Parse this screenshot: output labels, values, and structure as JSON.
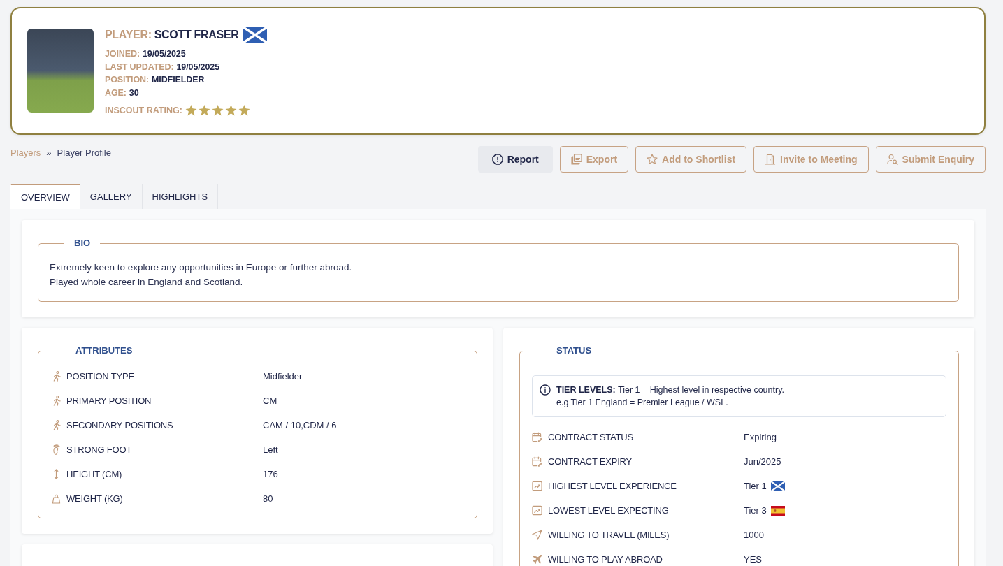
{
  "player": {
    "label": "PLAYER:",
    "name": "SCOTT FRASER",
    "flag": {
      "kind": "scotland"
    },
    "fields": [
      {
        "label": "JOINED:",
        "value": "19/05/2025"
      },
      {
        "label": "LAST UPDATED:",
        "value": "19/05/2025"
      },
      {
        "label": "POSITION:",
        "value": "MIDFIELDER"
      },
      {
        "label": "AGE:",
        "value": "30"
      }
    ],
    "rating": {
      "label": "INSCOUT RATING:",
      "stars": 5
    }
  },
  "breadcrumb": [
    {
      "label": "Players",
      "kind": "link"
    },
    {
      "label": "»",
      "kind": "separator"
    },
    {
      "label": "Player Profile",
      "kind": "current"
    }
  ],
  "actions": [
    {
      "label": "Report",
      "kind": "report"
    },
    {
      "label": "Export",
      "kind": "export"
    },
    {
      "label": "Add to Shortlist",
      "kind": "shortlist"
    },
    {
      "label": "Invite to Meeting",
      "kind": "meeting"
    },
    {
      "label": "Submit Enquiry",
      "kind": "enquiry"
    }
  ],
  "tabs": [
    {
      "label": "OVERVIEW",
      "selected": true
    },
    {
      "label": "GALLERY",
      "selected": false
    },
    {
      "label": "HIGHLIGHTS",
      "selected": false
    }
  ],
  "bio": {
    "title": "BIO",
    "text": "Extremely keen to explore any opportunities in Europe or further abroad.\nPlayed whole career in England and Scotland."
  },
  "attributes": {
    "title": "ATTRIBUTES",
    "rows": [
      {
        "kind": "position",
        "label": "POSITION TYPE",
        "value": "Midfielder"
      },
      {
        "kind": "position",
        "label": "PRIMARY POSITION",
        "value": "CM"
      },
      {
        "kind": "position",
        "label": "SECONDARY POSITIONS",
        "value": "CAM / 10,CDM / 6"
      },
      {
        "kind": "foot",
        "label": "STRONG FOOT",
        "value": "Left"
      },
      {
        "kind": "height",
        "label": "HEIGHT (CM)",
        "value": "176"
      },
      {
        "kind": "weight",
        "label": "WEIGHT (KG)",
        "value": "80"
      }
    ]
  },
  "status": {
    "title": "STATUS",
    "note": "**TIER LEVELS:** Tier 1 = Highest level in respective country.\ne.g Tier 1 England = Premier League / WSL.",
    "rows": [
      {
        "kind": "contract",
        "label": "CONTRACT STATUS",
        "value": "Expiring"
      },
      {
        "kind": "contract",
        "label": "CONTRACT EXPIRY",
        "value": "Jun/2025"
      },
      {
        "kind": "level",
        "label": "HIGHEST LEVEL EXPERIENCE",
        "value": "Tier 1",
        "flag": {
          "kind": "scotland"
        }
      },
      {
        "kind": "level",
        "label": "LOWEST LEVEL EXPECTING",
        "value": "Tier 3",
        "flag": {
          "kind": "spain"
        }
      },
      {
        "kind": "travel",
        "label": "WILLING TO TRAVEL (MILES)",
        "value": "1000"
      },
      {
        "kind": "abroad",
        "label": "WILLING TO PLAY ABROAD",
        "value": "YES"
      }
    ]
  }
}
